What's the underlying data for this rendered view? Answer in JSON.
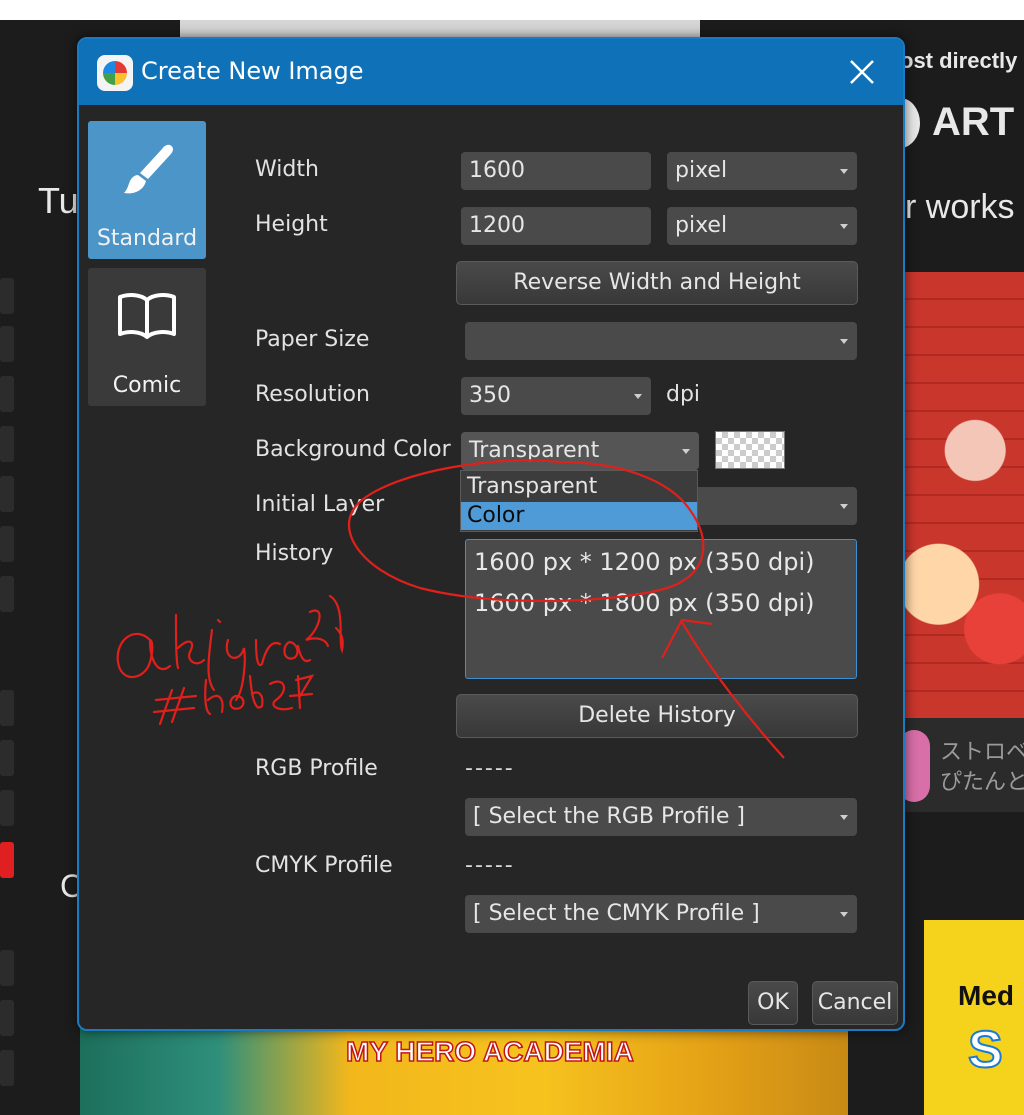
{
  "background": {
    "post_text": "ost directly",
    "arts_text": "ART",
    "tu_text": "Tu",
    "works_text": "r works",
    "c_text": "C",
    "card_line1": "ストロベ",
    "card_line2": "ぴたんと",
    "yellow_text": "Med",
    "yellow_s": "S",
    "bottom_title": "MY HERO ACADEMIA"
  },
  "dialog": {
    "title": "Create New Image",
    "tabs": [
      {
        "label": "Standard",
        "active": true,
        "icon": "brush-icon"
      },
      {
        "label": "Comic",
        "active": false,
        "icon": "book-icon"
      }
    ],
    "width": {
      "label": "Width",
      "value": "1600",
      "unit": "pixel"
    },
    "height": {
      "label": "Height",
      "value": "1200",
      "unit": "pixel"
    },
    "reverse_button": "Reverse Width and Height",
    "paper_size": {
      "label": "Paper Size",
      "value": ""
    },
    "resolution": {
      "label": "Resolution",
      "value": "350",
      "unit": "dpi"
    },
    "background_color": {
      "label": "Background Color",
      "value": "Transparent",
      "options": [
        "Transparent",
        "Color"
      ],
      "highlighted": "Color"
    },
    "initial_layer": {
      "label": "Initial Layer",
      "value": ""
    },
    "history": {
      "label": "History",
      "items": [
        "1600 px * 1200 px (350 dpi)",
        "1600 px * 1800 px (350 dpi)"
      ]
    },
    "delete_history_button": "Delete History",
    "rgb_profile": {
      "label": "RGB Profile",
      "value": "-----",
      "select": "[ Select the RGB Profile ]"
    },
    "cmyk_profile": {
      "label": "CMYK Profile",
      "value": "-----",
      "select": "[ Select the CMYK Profile ]"
    },
    "ok_button": "OK",
    "cancel_button": "Cancel"
  },
  "colors": {
    "titlebar": "#0f72b9",
    "dialog_bg": "#262626",
    "active_tab": "#4b95c9",
    "selection": "#4f9bd8",
    "annotation": "#e0201b"
  }
}
